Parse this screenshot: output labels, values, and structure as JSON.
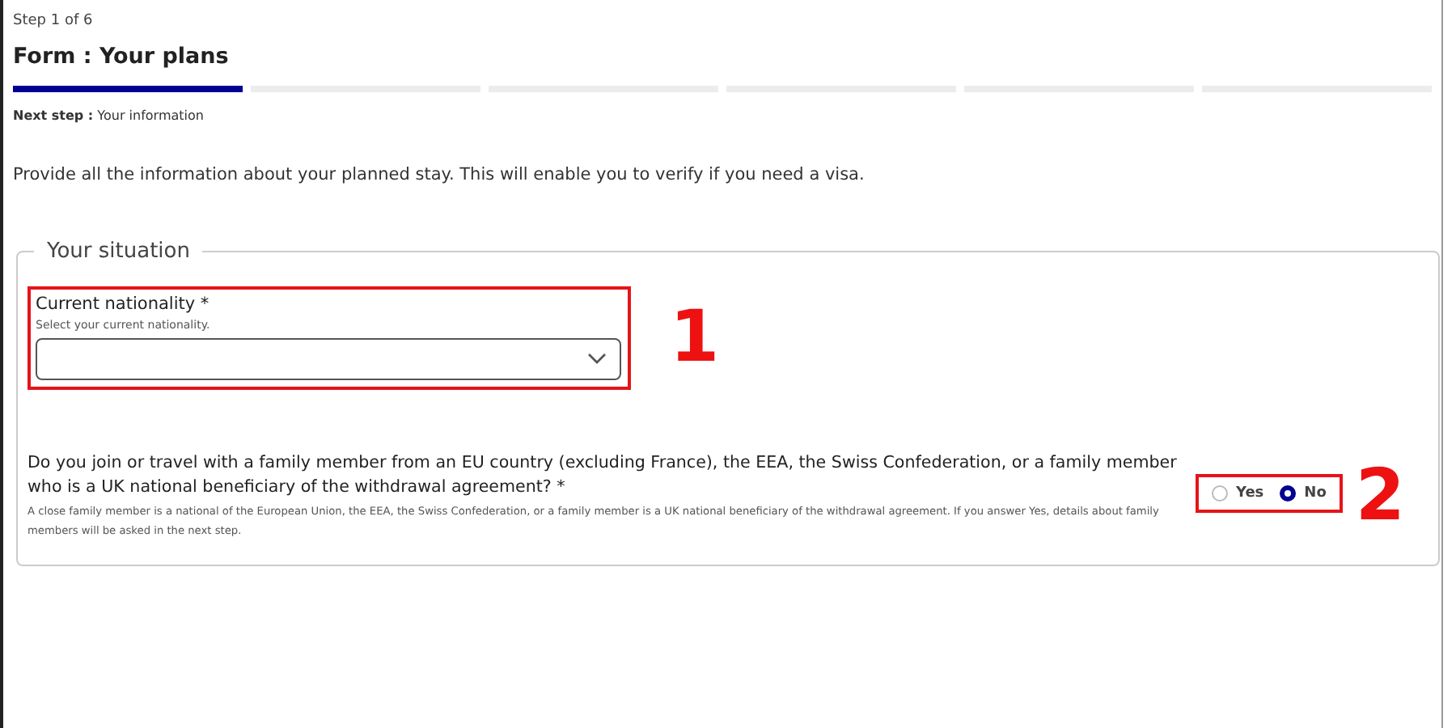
{
  "step_label": "Step 1 of 6",
  "title": "Form : Your plans",
  "progress_steps": [
    {
      "selected": true
    },
    {
      "selected": false
    },
    {
      "selected": false
    },
    {
      "selected": false
    },
    {
      "selected": false
    },
    {
      "selected": false
    }
  ],
  "next_step": {
    "label": "Next step :",
    "value": "Your information"
  },
  "intro": "Provide all the information about your planned stay. This will enable you to verify if you need a visa.",
  "section": {
    "legend": "Your situation",
    "nationality": {
      "label": "Current nationality *",
      "hint": "Select your current nationality.",
      "annotation": "1"
    },
    "family_question": {
      "label": "Do you join or travel with a family member from an EU country (excluding France), the EEA, the Swiss Confederation, or a family member who is a UK national beneficiary of the withdrawal agreement? *",
      "hint": "A close family member is a national of the European Union, the EEA, the Swiss Confederation, or a family member is a UK national beneficiary of the withdrawal agreement. If you answer Yes, details about family members will be asked in the next step.",
      "options": [
        {
          "label": "Yes",
          "selected": false
        },
        {
          "label": "No",
          "selected": true
        }
      ],
      "annotation": "2"
    }
  }
}
